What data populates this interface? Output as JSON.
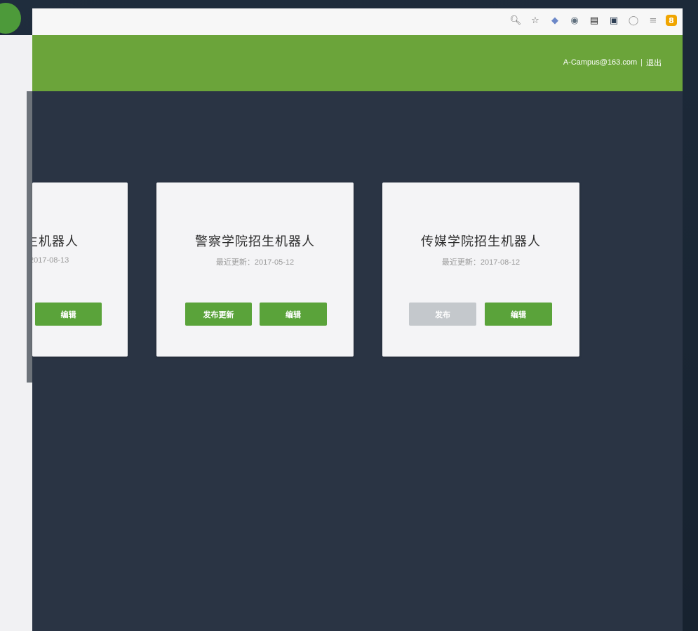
{
  "header": {
    "user_email": "A-Campus@163.com",
    "divider": "|",
    "logout_label": "退出"
  },
  "chrome": {
    "badge": "8"
  },
  "cards": [
    {
      "title": "生机器人",
      "updated": "2017-08-13",
      "buttons": [
        "编辑"
      ]
    },
    {
      "title": "警察学院招生机器人",
      "updated": "最近更新：2017-05-12",
      "buttons": [
        "发布更新",
        "编辑"
      ]
    },
    {
      "title": "传媒学院招生机器人",
      "updated": "最近更新：2017-08-12",
      "buttons": [
        "发布",
        "编辑"
      ]
    }
  ],
  "colors": {
    "header_green": "#6ba43a",
    "button_green": "#5aa33a",
    "button_disabled": "#c4c8cc",
    "content_bg": "#2a3444",
    "card_bg": "#f4f4f6"
  }
}
